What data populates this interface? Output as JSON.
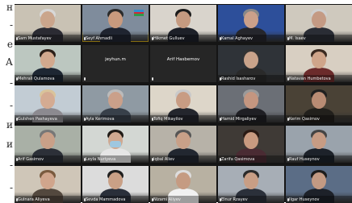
{
  "side_text": {
    "chars": [
      "н",
      "-",
      "е",
      "А",
      "-",
      "-",
      "и",
      "и",
      "-",
      "-"
    ]
  },
  "participants": [
    {
      "name": "Sam Mustafayev",
      "video": true
    },
    {
      "name": "Seyf Ahmadli",
      "video": true
    },
    {
      "name": "Hikmet Gulluev",
      "video": true
    },
    {
      "name": "Kamal Aghayev",
      "video": true
    },
    {
      "name": "M. Isaev",
      "video": true
    },
    {
      "name": "Mehrali Qulamova",
      "video": true
    },
    {
      "name": "jeyhun.m",
      "video": false
    },
    {
      "name": "Arif Hasbemov",
      "video": false
    },
    {
      "name": "Rashid Isasharov",
      "video": true
    },
    {
      "name": "Natavan Humbetova",
      "video": true
    },
    {
      "name": "Gulshen Pashayeva",
      "video": true
    },
    {
      "name": "Ayla Kerimova",
      "video": true
    },
    {
      "name": "Tofiq Mikayilov",
      "video": true
    },
    {
      "name": "Hamid Mirgaliyev",
      "video": true
    },
    {
      "name": "Kerim Qasimov",
      "video": true
    },
    {
      "name": "Arif Gasimov",
      "video": true
    },
    {
      "name": "Leyla Nuriyeva",
      "video": true
    },
    {
      "name": "Iqbal Aliev",
      "video": true
    },
    {
      "name": "Zarifa Qasimova",
      "video": true
    },
    {
      "name": "Rauf Huseynov",
      "video": true
    },
    {
      "name": "Gulnara Aliyeva",
      "video": true
    },
    {
      "name": "Sevda Mammadova",
      "video": true
    },
    {
      "name": "Nizami Aliyev",
      "video": true
    },
    {
      "name": "Elnur Rzayev",
      "video": true
    },
    {
      "name": "Ilgar Huseynov",
      "video": true
    }
  ],
  "colors": {
    "active_border": "#f0c419",
    "grid_background": "#151515"
  }
}
